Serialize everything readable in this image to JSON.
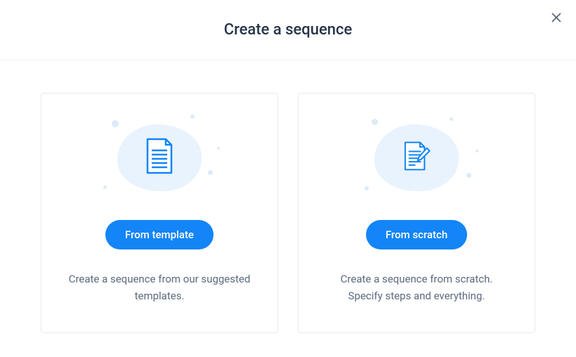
{
  "header": {
    "title": "Create a sequence"
  },
  "options": [
    {
      "button_label": "From template",
      "description": "Create a sequence from our suggested templates."
    },
    {
      "button_label": "From scratch",
      "description": "Create a sequence from scratch. Specify steps and everything."
    }
  ]
}
